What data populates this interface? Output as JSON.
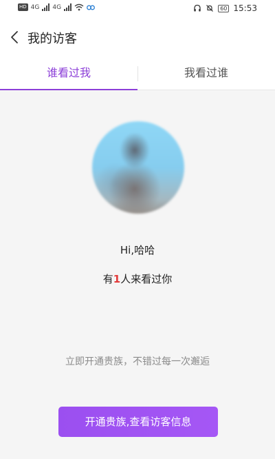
{
  "status_bar": {
    "left_badge": "HD",
    "network_1": "4G",
    "network_2": "4G",
    "battery": "60",
    "time": "15:53"
  },
  "header": {
    "title": "我的访客"
  },
  "tabs": [
    {
      "label": "谁看过我",
      "active": true
    },
    {
      "label": "我看过谁",
      "active": false
    }
  ],
  "main": {
    "greeting": "Hi,哈哈",
    "visitors_prefix": "有",
    "visitors_count": "1",
    "visitors_suffix": "人来看过你",
    "promo": "立即开通贵族，不错过每一次邂逅",
    "cta_label": "开通贵族,查看访客信息"
  },
  "colors": {
    "accent": "#8c3fd8",
    "button": "#9b4ff0",
    "count_highlight": "#e23b3b"
  }
}
